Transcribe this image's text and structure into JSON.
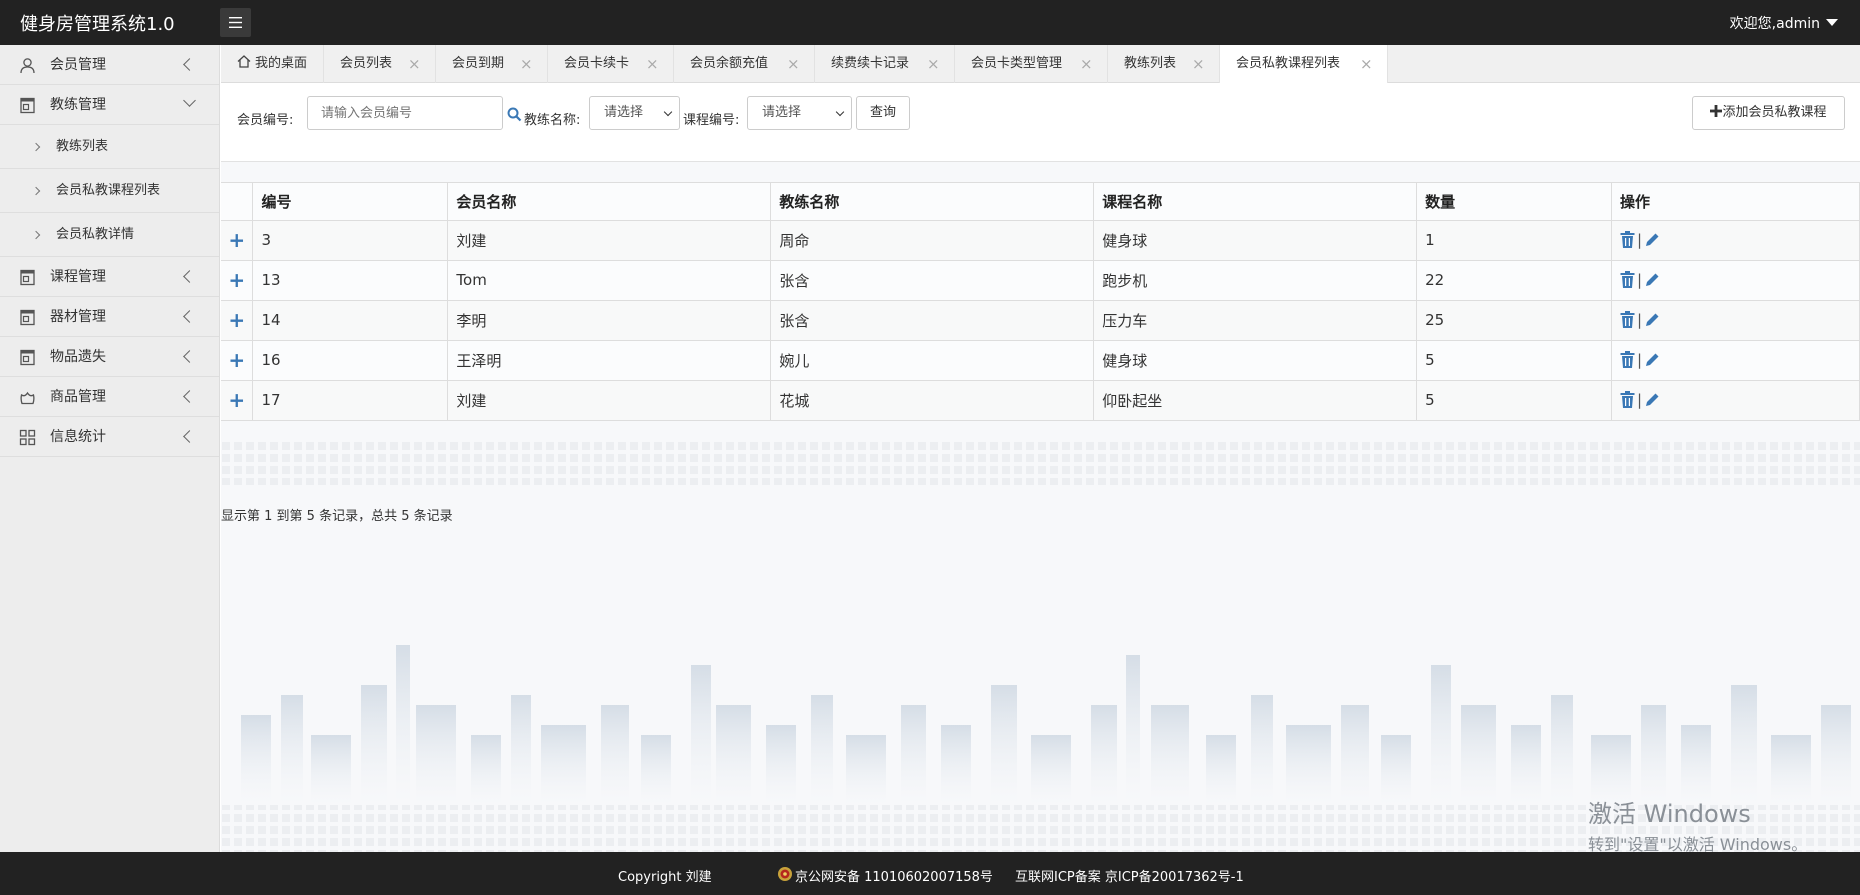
{
  "header": {
    "app_title": "健身房管理系统1.0",
    "user_greeting": "欢迎您,admin"
  },
  "sidebar": {
    "items": [
      {
        "label": "会员管理"
      },
      {
        "label": "教练管理"
      },
      {
        "label": "课程管理"
      },
      {
        "label": "器材管理"
      },
      {
        "label": "物品遗失"
      },
      {
        "label": "商品管理"
      },
      {
        "label": "信息统计"
      }
    ],
    "sub_items": [
      {
        "label": "教练列表"
      },
      {
        "label": "会员私教课程列表"
      },
      {
        "label": "会员私教详情"
      }
    ]
  },
  "tabs": [
    {
      "label": "我的桌面"
    },
    {
      "label": "会员列表"
    },
    {
      "label": "会员到期"
    },
    {
      "label": "会员卡续卡"
    },
    {
      "label": "会员余额充值"
    },
    {
      "label": "续费续卡记录"
    },
    {
      "label": "会员卡类型管理"
    },
    {
      "label": "教练列表"
    },
    {
      "label": "会员私教课程列表"
    }
  ],
  "tab_close_glyph": "×",
  "search": {
    "member_no_label": "会员编号:",
    "member_no_placeholder": "请输入会员编号",
    "coach_label": "教练名称:",
    "coach_value": "请选择",
    "course_label": "课程编号:",
    "course_value": "请选择",
    "query_label": "查询",
    "add_label": "添加会员私教课程"
  },
  "table": {
    "columns": [
      "编号",
      "会员名称",
      "教练名称",
      "课程名称",
      "数量",
      "操作"
    ],
    "rows": [
      {
        "id": "3",
        "member": "刘建",
        "coach": "周命",
        "course": "健身球",
        "qty": "1"
      },
      {
        "id": "13",
        "member": "Tom",
        "coach": "张含",
        "course": "跑步机",
        "qty": "22"
      },
      {
        "id": "14",
        "member": "李明",
        "coach": "张含",
        "course": "压力车",
        "qty": "25"
      },
      {
        "id": "16",
        "member": "王泽明",
        "coach": "婉儿",
        "course": "健身球",
        "qty": "5"
      },
      {
        "id": "17",
        "member": "刘建",
        "coach": "花城",
        "course": "仰卧起坐",
        "qty": "5"
      }
    ],
    "expand_glyph": "+",
    "op_separator": "|"
  },
  "pager": {
    "summary": "显示第 1 到第 5 条记录，总共 5 条记录"
  },
  "windows_watermark": {
    "line1": "激活 Windows",
    "line2": "转到\"设置\"以激活 Windows。"
  },
  "footer": {
    "copyright": "Copyright 刘建",
    "police_record": "京公网安备 11010602007158号",
    "icp_record": "互联网ICP备案 京ICP备20017362号-1"
  },
  "colors": {
    "header_bg": "#222222",
    "sidebar_bg": "#ededed",
    "accent_blue": "#3a78b5"
  }
}
